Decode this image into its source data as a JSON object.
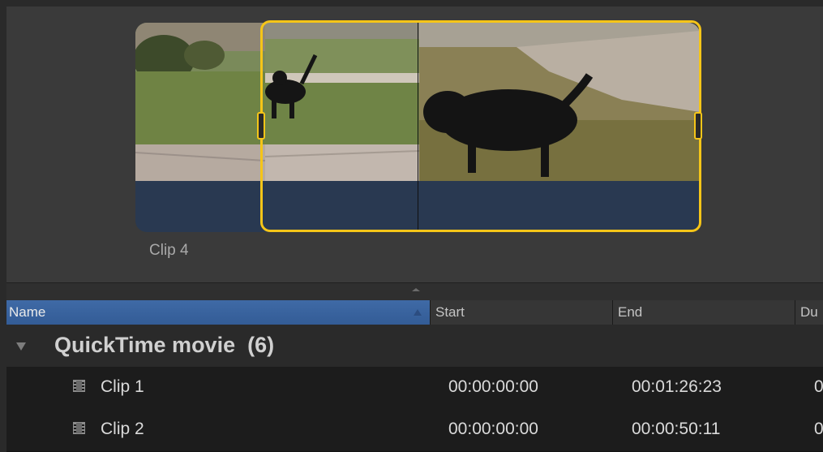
{
  "preview": {
    "clip_caption": "Clip 4",
    "selection_color": "#f5c518",
    "clip_bar_color": "#293951"
  },
  "list": {
    "columns": {
      "name": "Name",
      "start": "Start",
      "end": "End",
      "duration": "Du"
    },
    "group": {
      "title": "QuickTime movie  (6)"
    },
    "rows": [
      {
        "name": "Clip 1",
        "start": "00:00:00:00",
        "end": "00:01:26:23",
        "duration": "0"
      },
      {
        "name": "Clip 2",
        "start": "00:00:00:00",
        "end": "00:00:50:11",
        "duration": "0"
      }
    ],
    "header_selected_color": "#3f6aa6"
  }
}
